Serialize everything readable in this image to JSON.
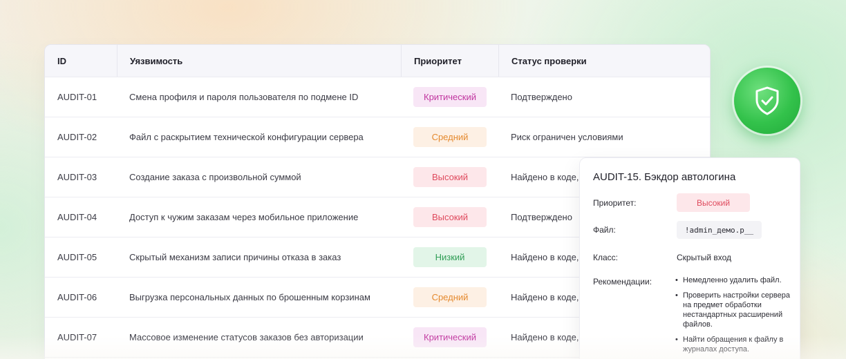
{
  "table": {
    "headers": {
      "id": "ID",
      "vuln": "Уязвимость",
      "priority": "Приоритет",
      "status": "Статус проверки"
    },
    "rows": [
      {
        "id": "AUDIT-01",
        "vuln": "Смена профиля и пароля пользователя по подмене ID",
        "priority": "Критический",
        "level": "critical",
        "status": "Подтверждено"
      },
      {
        "id": "AUDIT-02",
        "vuln": "Файл с раскрытием технической конфигурации сервера",
        "priority": "Средний",
        "level": "medium",
        "status": "Риск ограничен условиями"
      },
      {
        "id": "AUDIT-03",
        "vuln": "Создание заказа с произвольной суммой",
        "priority": "Высокий",
        "level": "high",
        "status": "Найдено в коде,"
      },
      {
        "id": "AUDIT-04",
        "vuln": "Доступ к чужим заказам через мобильное приложение",
        "priority": "Высокий",
        "level": "high",
        "status": "Подтверждено"
      },
      {
        "id": "AUDIT-05",
        "vuln": "Скрытый механизм записи причины отказа в заказ",
        "priority": "Низкий",
        "level": "low",
        "status": "Найдено в коде,"
      },
      {
        "id": "AUDIT-06",
        "vuln": "Выгрузка персональных данных по брошенным корзинам",
        "priority": "Средний",
        "level": "medium",
        "status": "Найдено в коде,"
      },
      {
        "id": "AUDIT-07",
        "vuln": "Массовое изменение статусов заказов без авторизации",
        "priority": "Критический",
        "level": "critical",
        "status": "Найдено в коде,"
      }
    ]
  },
  "badge_icon": "shield-check-icon",
  "detail": {
    "title": "AUDIT-15. Бэкдор автологина",
    "priority_label": "Приоритет:",
    "priority_value": "Высокий",
    "file_label": "Файл:",
    "file_value": "!admin_демо.p__",
    "class_label": "Класс:",
    "class_value": "Скрытый вход",
    "recs_label": "Рекомендации:",
    "recommendations": [
      "Немедленно удалить файл.",
      "Проверить настройки сервера на предмет обработки нестандартных расширений файлов.",
      "Найти обращения к файлу в журналах доступа."
    ]
  },
  "colors": {
    "critical": "#c0359f",
    "high": "#df4a5d",
    "medium": "#e58a2f",
    "low": "#2f9d55",
    "shield": "#33c24b"
  }
}
